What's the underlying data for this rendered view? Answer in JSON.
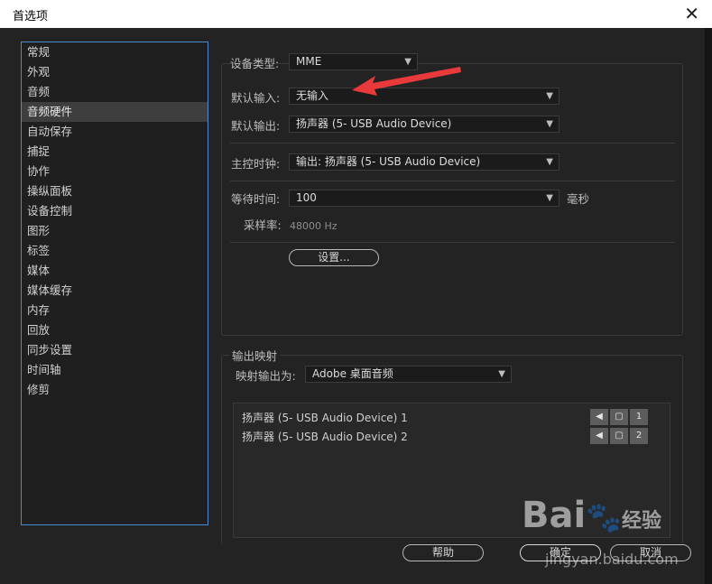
{
  "window": {
    "title": "首选项",
    "close_glyph": "✕"
  },
  "sidebar": {
    "items": [
      {
        "label": "常规"
      },
      {
        "label": "外观"
      },
      {
        "label": "音频"
      },
      {
        "label": "音频硬件"
      },
      {
        "label": "自动保存"
      },
      {
        "label": "捕捉"
      },
      {
        "label": "协作"
      },
      {
        "label": "操纵面板"
      },
      {
        "label": "设备控制"
      },
      {
        "label": "图形"
      },
      {
        "label": "标签"
      },
      {
        "label": "媒体"
      },
      {
        "label": "媒体缓存"
      },
      {
        "label": "内存"
      },
      {
        "label": "回放"
      },
      {
        "label": "同步设置"
      },
      {
        "label": "时间轴"
      },
      {
        "label": "修剪"
      }
    ],
    "selected": "音频硬件"
  },
  "device": {
    "type_label": "设备类型:",
    "type_value": "MME",
    "input_label": "默认输入:",
    "input_value": "无输入",
    "output_label": "默认输出:",
    "output_value": "扬声器 (5- USB Audio Device)",
    "clock_label": "主控时钟:",
    "clock_value": "输出: 扬声器 (5- USB Audio Device)",
    "latency_label": "等待时间:",
    "latency_value": "100",
    "latency_unit": "毫秒",
    "samplerate_label": "采样率:",
    "samplerate_value": "48000 Hz",
    "settings_button": "设置..."
  },
  "mapping": {
    "section_label": "输出映射",
    "map_label": "映射输出为:",
    "map_value": "Adobe 桌面音频",
    "rows": [
      {
        "name": "扬声器 (5- USB Audio Device) 1",
        "channel": "1"
      },
      {
        "name": "扬声器 (5- USB Audio Device) 2",
        "channel": "2"
      }
    ]
  },
  "footer": {
    "help_button": "帮助",
    "ok_button": "确定",
    "cancel_button": "取消"
  },
  "watermark": {
    "brand": "Bai",
    "paw": "🐾",
    "suffix": "经验",
    "url": "jingyan.baidu.com"
  },
  "colors": {
    "selection": "#3e3e3e",
    "nav_border": "#4b8ad2",
    "arrow": "#e8393b"
  }
}
